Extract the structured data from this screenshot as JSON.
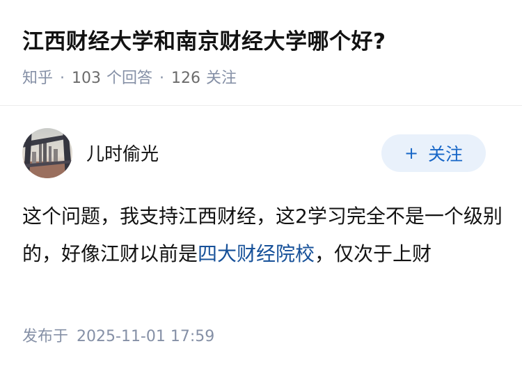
{
  "question": {
    "title": "江西财经大学和南京财经大学哪个好?",
    "source": "知乎",
    "answer_count": "103",
    "answer_label": "个回答",
    "follower_count": "126",
    "follower_label": "关注"
  },
  "answer": {
    "author_name": "儿时偷光",
    "follow_plus": "+",
    "follow_label": "关注",
    "content_before": "这个问题，我支持江西财经，这2学习完全不是一个级别的，好像江财以前是",
    "content_link": "四大财经院校",
    "content_after": "，仅次于上财",
    "published_label": "发布于",
    "published_time": "2025-11-01 17:59"
  }
}
